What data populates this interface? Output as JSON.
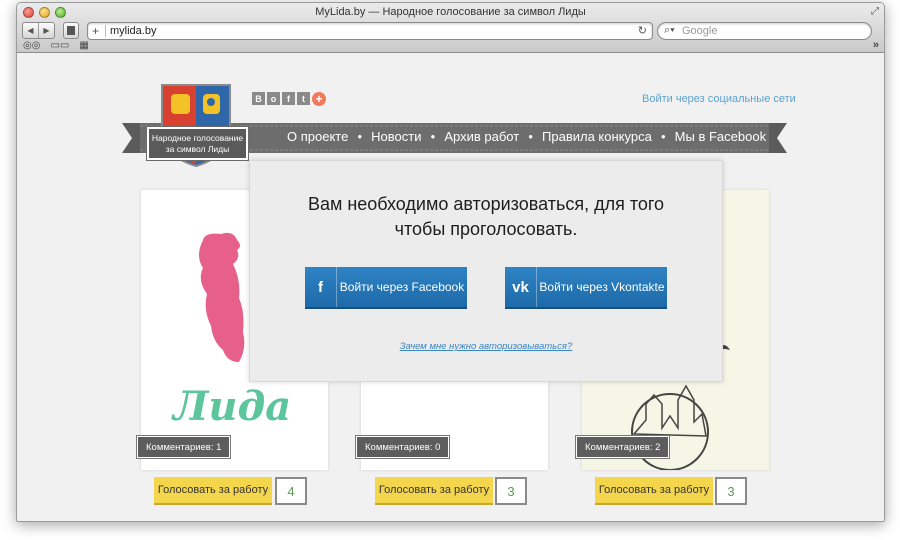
{
  "window": {
    "title": "MyLida.by — Народное голосование за символ Лиды"
  },
  "browser": {
    "url": "mylida.by",
    "search_placeholder": "Google",
    "icons": {
      "back": "back-arrow-icon",
      "forward": "forward-arrow-icon",
      "reload": "reload-icon",
      "search": "search-icon"
    }
  },
  "header": {
    "logo_text_line1": "Народное голосование",
    "logo_text_line2": "за символ Лиды",
    "share_icons": [
      "В",
      "о",
      "f",
      "t",
      "+"
    ],
    "login_link": "Войти через социальные сети"
  },
  "nav": {
    "items": [
      "О проекте",
      "Новости",
      "Архив работ",
      "Правила конкурса",
      "Мы в Facebook"
    ]
  },
  "cards": [
    {
      "comments": "Комментариев: 1",
      "vote_label": "Голосовать за работу",
      "votes": "4",
      "image_text": "Лида"
    },
    {
      "comments": "Комментариев: 0",
      "vote_label": "Голосовать за работу",
      "votes": "3"
    },
    {
      "comments": "Комментариев: 2",
      "vote_label": "Голосовать за работу",
      "votes": "3"
    }
  ],
  "modal": {
    "title_line1": "Вам необходимо авторизоваться, для того",
    "title_line2": "чтобы проголосовать.",
    "facebook": {
      "icon": "f",
      "label": "Войти через Facebook"
    },
    "vkontakte": {
      "icon": "vk",
      "label": "Войти через Vkontakte"
    },
    "why_link": "Зачем мне нужно авторизовываться?"
  },
  "colors": {
    "accent_blue": "#1d6aa9",
    "vote_yellow": "#f4d64c",
    "nav_gray": "#6d6d6d",
    "link_blue": "#59a3d1"
  }
}
